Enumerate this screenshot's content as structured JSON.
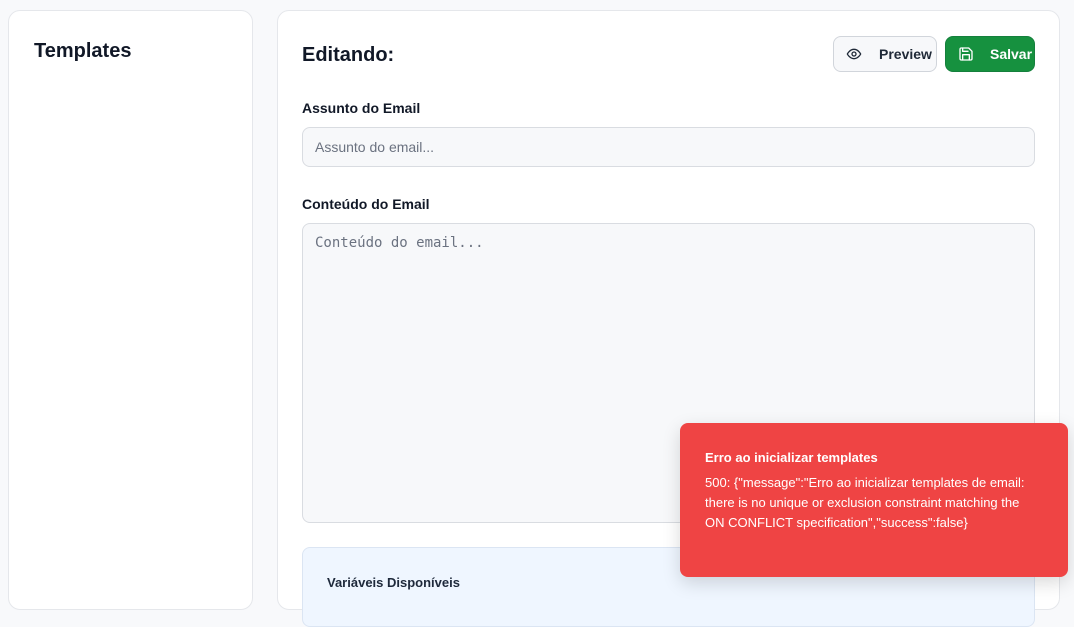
{
  "sidebar": {
    "title": "Templates"
  },
  "editor": {
    "title": "Editando:",
    "preview_button": {
      "label": "Preview",
      "icon": "eye-icon"
    },
    "save_button": {
      "label": "Salvar",
      "icon": "floppy-disk-icon"
    },
    "subject": {
      "label": "Assunto do Email",
      "placeholder": "Assunto do email...",
      "value": ""
    },
    "content": {
      "label": "Conteúdo do Email",
      "placeholder": "Conteúdo do email...",
      "value": ""
    },
    "variables": {
      "title": "Variáveis Disponíveis"
    }
  },
  "toast": {
    "title": "Erro ao inicializar templates",
    "message": "500: {\"message\":\"Erro ao inicializar templates de email: there is no unique or exclusion constraint matching the ON CONFLICT specification\",\"success\":false}",
    "color": "#ef4444"
  },
  "colors": {
    "accent": "#16913f",
    "error": "#ef4444",
    "info_bg": "#eff6ff"
  }
}
